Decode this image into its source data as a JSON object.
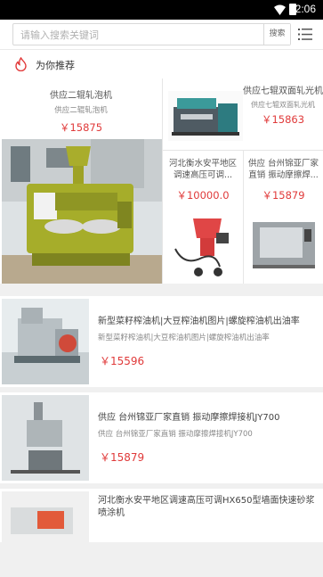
{
  "status": {
    "time": "2:06"
  },
  "search": {
    "placeholder": "请输入搜索关键词",
    "button": "搜索"
  },
  "recommend": {
    "title": "为你推荐"
  },
  "grid": {
    "big": {
      "title": "供应二辊轧泡机",
      "sub": "供应二辊轧泡机",
      "price": "￥15875"
    },
    "top_right": {
      "title": "供应七辊双面轧光机",
      "sub": "供应七辊双面轧光机",
      "price": "￥15863"
    },
    "mid_left": {
      "title": "河北衡水安平地区调速高压可调...",
      "price": "￥10000.0"
    },
    "mid_right": {
      "title": "供应 台州锦亚厂家直销 振动摩擦焊...",
      "price": "￥15879"
    }
  },
  "list": [
    {
      "title": "新型菜籽榨油机|大豆榨油机图片|螺旋榨油机出油率",
      "sub": "新型菜籽榨油机|大豆榨油机图片|螺旋榨油机出油率",
      "price": "￥15596"
    },
    {
      "title": "供应 台州锦亚厂家直销 振动摩擦焊接机JY700",
      "sub": "供应 台州锦亚厂家直销 振动摩擦焊接机JY700",
      "price": "￥15879"
    },
    {
      "title": "河北衡水安平地区调速高压可调HX650型墙面快速砂浆喷涂机",
      "sub": "",
      "price": ""
    }
  ]
}
